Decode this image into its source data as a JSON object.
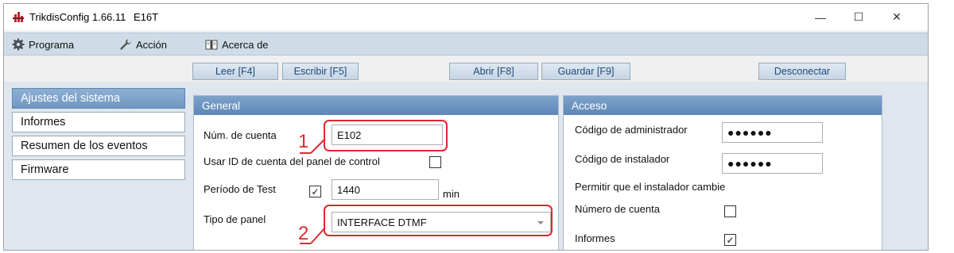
{
  "window": {
    "app_name": "TrikdisConfig 1.66.11",
    "device": "E16T",
    "minimize": "—",
    "maximize": "☐",
    "close": "✕"
  },
  "menu": {
    "items": [
      {
        "label": "Programa",
        "icon": "gear-icon"
      },
      {
        "label": "Acción",
        "icon": "wrench-icon"
      },
      {
        "label": "Acerca de",
        "icon": "book-icon"
      }
    ]
  },
  "toolbar": {
    "read": "Leer [F4]",
    "write": "Escribir [F5]",
    "open": "Abrir [F8]",
    "save": "Guardar [F9]",
    "disconnect": "Desconectar"
  },
  "nav": {
    "items": [
      {
        "label": "Ajustes del sistema",
        "active": true
      },
      {
        "label": "Informes",
        "active": false
      },
      {
        "label": "Resumen de los eventos",
        "active": false
      },
      {
        "label": "Firmware",
        "active": false
      }
    ]
  },
  "general": {
    "title": "General",
    "account_label": "Núm. de cuenta",
    "account_value": "E102",
    "use_panel_id_label": "Usar ID de cuenta del panel de control",
    "use_panel_id_checked": false,
    "test_period_label": "Período de Test",
    "test_period_checked": true,
    "test_period_value": "1440",
    "test_period_unit": "min",
    "panel_type_label": "Tipo de panel",
    "panel_type_value": "INTERFACE DTMF"
  },
  "acceso": {
    "title": "Acceso",
    "admin_code_label": "Código de administrador",
    "admin_code_value": "●●●●●●",
    "installer_code_label": "Código de instalador",
    "installer_code_value": "●●●●●●",
    "allow_change_label": "Permitir que el instalador cambie",
    "account_number_label": "Número de cuenta",
    "account_number_checked": false,
    "reports_label": "Informes",
    "reports_checked": true
  },
  "callouts": {
    "one": "1",
    "two": "2"
  },
  "colors": {
    "accent": "#6f97c2",
    "callout": "#e0282e",
    "menubar": "#cfdce8"
  }
}
